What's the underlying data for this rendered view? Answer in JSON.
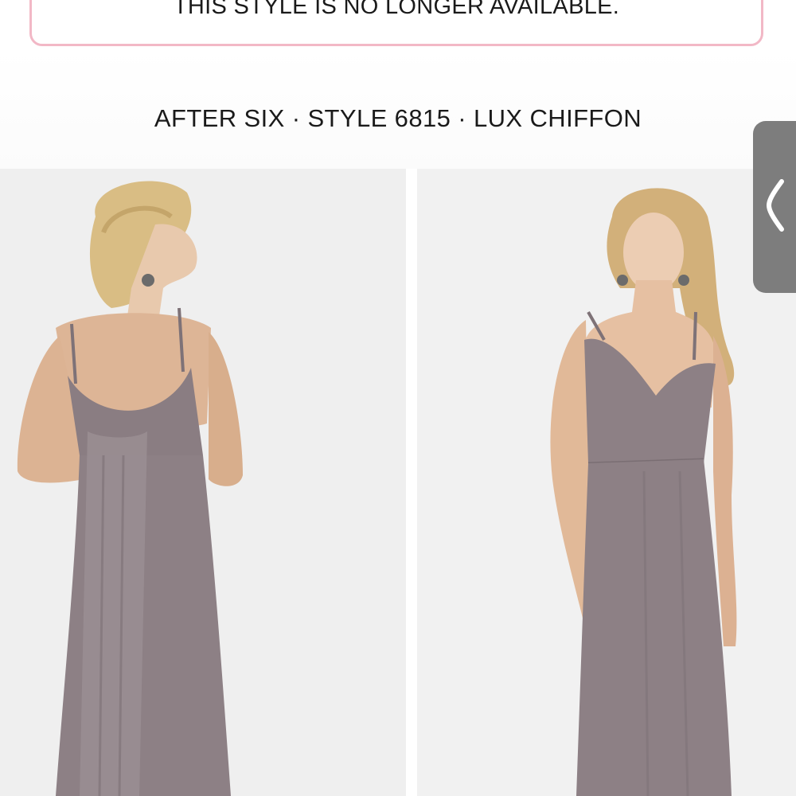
{
  "notice": {
    "text": "THIS STYLE IS NO LONGER AVAILABLE."
  },
  "product": {
    "title": "AFTER SIX · STYLE 6815 · LUX CHIFFON"
  },
  "gallery": {
    "images": [
      {
        "view": "back",
        "dress_color": "#8d8085"
      },
      {
        "view": "front",
        "dress_color": "#8d8085"
      }
    ]
  },
  "side_tab": {
    "icon": "chevron-left-icon"
  },
  "colors": {
    "notice_border": "#f2b8c6",
    "side_tab": "#7d7d7d",
    "photo_bg": "#efefef"
  }
}
